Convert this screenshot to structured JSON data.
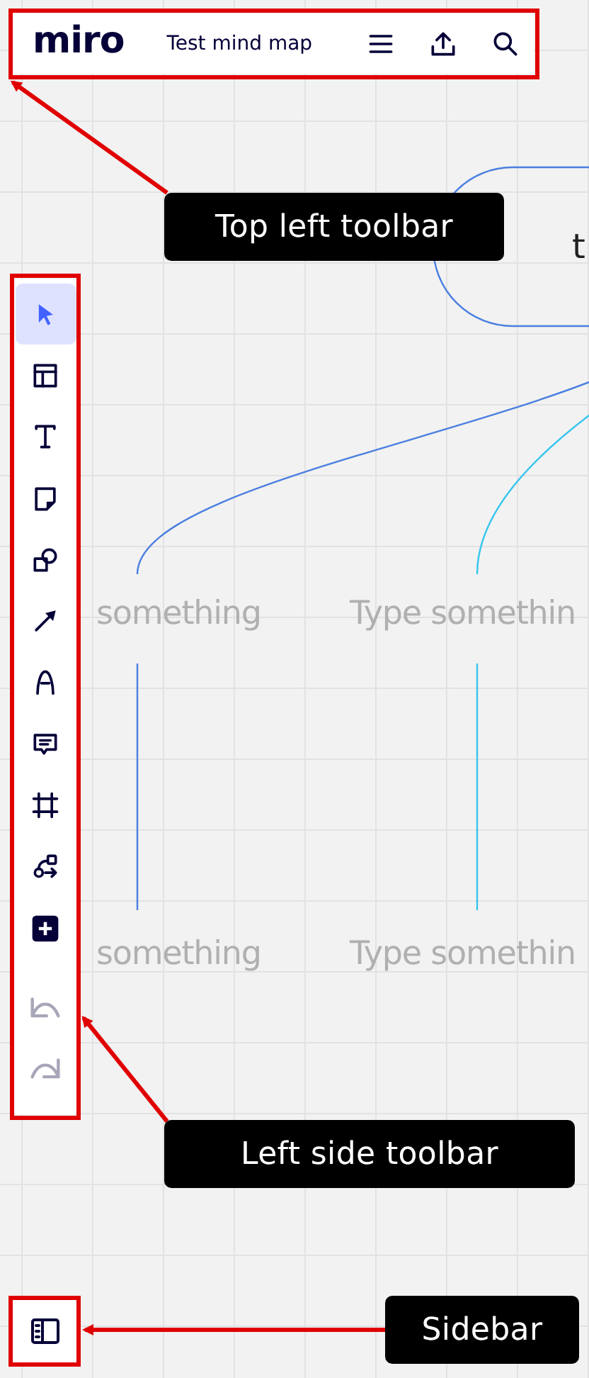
{
  "top_toolbar": {
    "logo": "miro",
    "board_title": "Test mind map",
    "actions": [
      {
        "kind": "menu"
      },
      {
        "kind": "upload"
      },
      {
        "kind": "search"
      }
    ]
  },
  "left_toolbar": {
    "tools": [
      {
        "kind": "select",
        "selected": true
      },
      {
        "kind": "templates",
        "selected": false
      },
      {
        "kind": "text",
        "selected": false
      },
      {
        "kind": "sticky",
        "selected": false
      },
      {
        "kind": "shapes",
        "selected": false
      },
      {
        "kind": "line",
        "selected": false
      },
      {
        "kind": "pen",
        "selected": false
      },
      {
        "kind": "comment",
        "selected": false
      },
      {
        "kind": "frame",
        "selected": false
      },
      {
        "kind": "diagram",
        "selected": false
      },
      {
        "kind": "add",
        "selected": false
      }
    ],
    "history": [
      {
        "kind": "undo",
        "disabled": true
      },
      {
        "kind": "redo",
        "disabled": true
      }
    ]
  },
  "sidebar_button": {
    "kind": "sidebar"
  },
  "mind_map": {
    "root_text": "t",
    "children": [
      {
        "text": "something",
        "children": [
          {
            "text": "something"
          }
        ]
      },
      {
        "text": "Type somethin",
        "children": [
          {
            "text": "Type somethin"
          }
        ]
      }
    ]
  },
  "annotations": [
    {
      "label": "Top left toolbar"
    },
    {
      "label": "Left side toolbar"
    },
    {
      "label": "Sidebar"
    }
  ]
}
